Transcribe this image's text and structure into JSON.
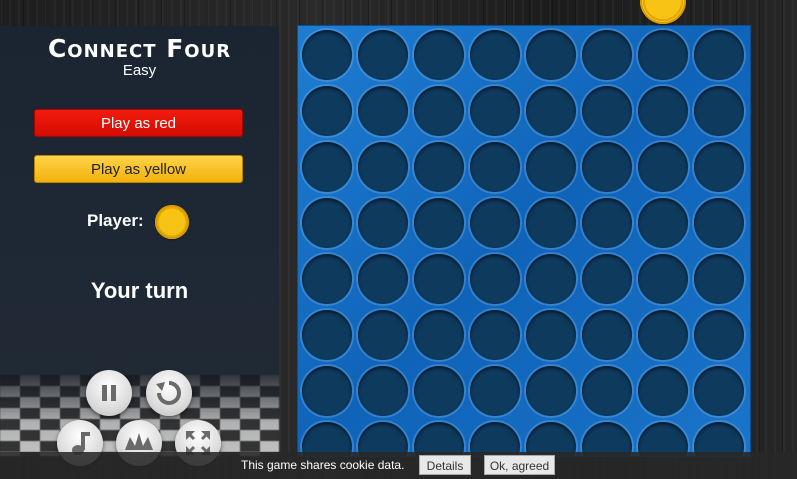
{
  "game": {
    "title": "Connect Four",
    "difficulty": "Easy",
    "play_red_label": "Play as red",
    "play_yellow_label": "Play as yellow",
    "player_label": "Player:",
    "player_color": "yellow",
    "status": "Your turn"
  },
  "board": {
    "columns": 8,
    "rows": 8,
    "pending_coin": "yellow"
  },
  "controls": [
    "pause-icon",
    "restart-icon",
    "music-icon",
    "sound-effects-icon",
    "fullscreen-icon"
  ],
  "cookie": {
    "text": "This game shares cookie data.",
    "details_label": "Details",
    "agree_label": "Ok, agreed"
  },
  "colors": {
    "red": "#e8140a",
    "yellow": "#f7c415",
    "board": "#0f63b8",
    "panel": "#1d2733"
  }
}
